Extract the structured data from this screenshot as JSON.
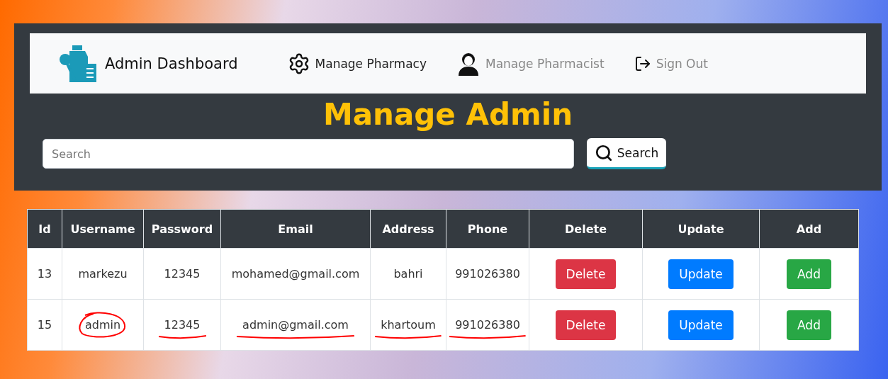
{
  "navbar": {
    "brand": "Admin Dashboard",
    "items": [
      {
        "label": "Manage Pharmacy",
        "kind": "gear",
        "active": true
      },
      {
        "label": "Manage Pharmacist",
        "kind": "person",
        "active": false
      },
      {
        "label": "Sign Out",
        "kind": "signout",
        "active": false
      }
    ]
  },
  "title": "Manage Admin",
  "search": {
    "placeholder": "Search",
    "button": "Search"
  },
  "table": {
    "columns": [
      "Id",
      "Username",
      "Password",
      "Email",
      "Address",
      "Phone",
      "Delete",
      "Update",
      "Add"
    ],
    "rows": [
      {
        "cells": [
          {
            "text": "13",
            "kind": "plain"
          },
          {
            "text": "markezu",
            "kind": "plain"
          },
          {
            "text": "12345",
            "kind": "plain"
          },
          {
            "text": "mohamed@gmail.com",
            "kind": "plain"
          },
          {
            "text": "bahri",
            "kind": "plain"
          },
          {
            "text": "991026380",
            "kind": "plain"
          }
        ],
        "actions": [
          {
            "label": "Delete",
            "kind": "delete"
          },
          {
            "label": "Update",
            "kind": "update"
          },
          {
            "label": "Add",
            "kind": "add"
          }
        ]
      },
      {
        "cells": [
          {
            "text": "15",
            "kind": "plain"
          },
          {
            "text": "admin",
            "kind": "circled"
          },
          {
            "text": "12345",
            "kind": "underlined"
          },
          {
            "text": "admin@gmail.com",
            "kind": "underlined"
          },
          {
            "text": "khartoum",
            "kind": "underlined"
          },
          {
            "text": "991026380",
            "kind": "underlined"
          }
        ],
        "actions": [
          {
            "label": "Delete",
            "kind": "delete"
          },
          {
            "label": "Update",
            "kind": "update"
          },
          {
            "label": "Add",
            "kind": "add"
          }
        ]
      }
    ]
  }
}
